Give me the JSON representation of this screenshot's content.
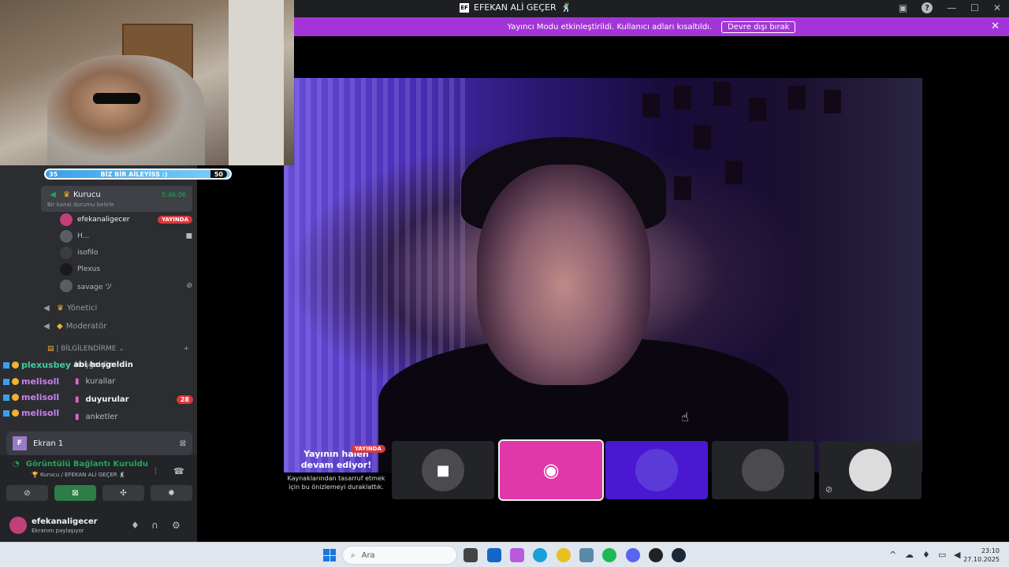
{
  "window": {
    "title": "EFEKAN ALİ GEÇER",
    "title_suffix": "🕺"
  },
  "banner": {
    "message": "Yayıncı Modu etkinleştirildi. Kullanıcı adları kısaltıldı.",
    "button": "Devre dışı bırak"
  },
  "hype_bar": {
    "left_value": "35",
    "label": "BİZ BİR AİLEYİSS :)",
    "right_value": "50"
  },
  "voice_channel": {
    "name": "Kurucu",
    "time": "5:46:06",
    "status_placeholder": "Bir kanal durumu belirle"
  },
  "members": [
    {
      "name": "efekanaligecer",
      "badge": "YAYINDA"
    },
    {
      "name": "H..."
    },
    {
      "name": "isofilo"
    },
    {
      "name": "Plexus"
    },
    {
      "name": "savage ツ"
    }
  ],
  "channels": {
    "yonetici": "Yönetici",
    "moderator": "Moderatör",
    "category": "| BİLGİLENDİRME"
  },
  "sub_channels": [
    {
      "name": "hoşgeldin"
    },
    {
      "name": "kurallar"
    },
    {
      "name": "duyurular",
      "count": "28"
    },
    {
      "name": "anketler"
    }
  ],
  "chat_overlay": [
    {
      "user": "plexusbey",
      "text": "abi hoşgeldin",
      "color": "#3ad0a0"
    },
    {
      "user": "melisoll",
      "text": "",
      "color": "#c880f0"
    },
    {
      "user": "melisoll",
      "text": "",
      "color": "#c880f0"
    },
    {
      "user": "melisoll",
      "text": "",
      "color": "#c880f0"
    }
  ],
  "screen_share": {
    "label": "Ekran 1"
  },
  "voice_status": {
    "connected": "Görüntülü Bağlantı Kuruldu",
    "location": "🏆 Kurucu / EFEKAN ALİ GEÇER 🕺"
  },
  "user_panel": {
    "name": "efekanaligecer",
    "status": "Ekranını paylaşıyor"
  },
  "preview_paused": {
    "badge": "YAYINDA",
    "title": "Yayının halen devam ediyor!",
    "body": "Kaynaklarından tasarruf etmek için bu önizlemeyi duraklattık."
  },
  "taskbar": {
    "search_placeholder": "Ara",
    "time": "23:10",
    "date": "27.10.2025"
  },
  "colors": {
    "banner": "#a335d8",
    "live_red": "#da373c",
    "connected_green": "#23a55a"
  }
}
